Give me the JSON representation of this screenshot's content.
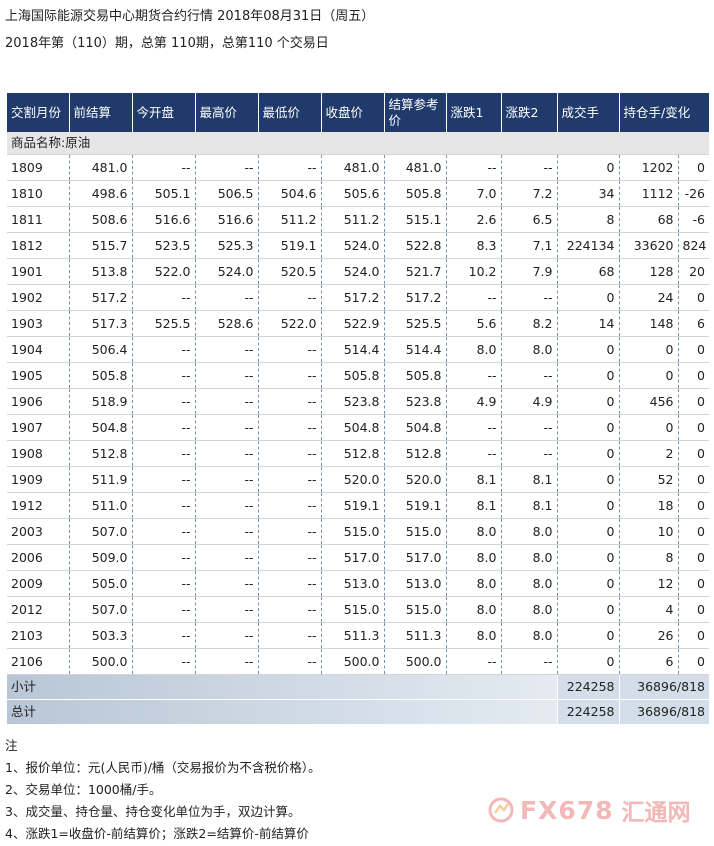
{
  "title_line1": "上海国际能源交易中心期货合约行情 2018年08月31日（周五）",
  "title_line2": "2018年第（110）期，总第 110期，总第110 个交易日",
  "table": {
    "headers": [
      "交割月份",
      "前结算",
      "今开盘",
      "最高价",
      "最低价",
      "收盘价",
      "结算参考价",
      "涨跌1",
      "涨跌2",
      "成交手",
      "持仓手/变化"
    ],
    "category": "商品名称:原油",
    "rows": [
      [
        "1809",
        "481.0",
        "--",
        "--",
        "--",
        "481.0",
        "481.0",
        "--",
        "--",
        "0",
        "1202",
        "0"
      ],
      [
        "1810",
        "498.6",
        "505.1",
        "506.5",
        "504.6",
        "505.6",
        "505.8",
        "7.0",
        "7.2",
        "34",
        "1112",
        "-26"
      ],
      [
        "1811",
        "508.6",
        "516.6",
        "516.6",
        "511.2",
        "511.2",
        "515.1",
        "2.6",
        "6.5",
        "8",
        "68",
        "-6"
      ],
      [
        "1812",
        "515.7",
        "523.5",
        "525.3",
        "519.1",
        "524.0",
        "522.8",
        "8.3",
        "7.1",
        "224134",
        "33620",
        "824"
      ],
      [
        "1901",
        "513.8",
        "522.0",
        "524.0",
        "520.5",
        "524.0",
        "521.7",
        "10.2",
        "7.9",
        "68",
        "128",
        "20"
      ],
      [
        "1902",
        "517.2",
        "--",
        "--",
        "--",
        "517.2",
        "517.2",
        "--",
        "--",
        "0",
        "24",
        "0"
      ],
      [
        "1903",
        "517.3",
        "525.5",
        "528.6",
        "522.0",
        "522.9",
        "525.5",
        "5.6",
        "8.2",
        "14",
        "148",
        "6"
      ],
      [
        "1904",
        "506.4",
        "--",
        "--",
        "--",
        "514.4",
        "514.4",
        "8.0",
        "8.0",
        "0",
        "0",
        "0"
      ],
      [
        "1905",
        "505.8",
        "--",
        "--",
        "--",
        "505.8",
        "505.8",
        "--",
        "--",
        "0",
        "0",
        "0"
      ],
      [
        "1906",
        "518.9",
        "--",
        "--",
        "--",
        "523.8",
        "523.8",
        "4.9",
        "4.9",
        "0",
        "456",
        "0"
      ],
      [
        "1907",
        "504.8",
        "--",
        "--",
        "--",
        "504.8",
        "504.8",
        "--",
        "--",
        "0",
        "0",
        "0"
      ],
      [
        "1908",
        "512.8",
        "--",
        "--",
        "--",
        "512.8",
        "512.8",
        "--",
        "--",
        "0",
        "2",
        "0"
      ],
      [
        "1909",
        "511.9",
        "--",
        "--",
        "--",
        "520.0",
        "520.0",
        "8.1",
        "8.1",
        "0",
        "52",
        "0"
      ],
      [
        "1912",
        "511.0",
        "--",
        "--",
        "--",
        "519.1",
        "519.1",
        "8.1",
        "8.1",
        "0",
        "18",
        "0"
      ],
      [
        "2003",
        "507.0",
        "--",
        "--",
        "--",
        "515.0",
        "515.0",
        "8.0",
        "8.0",
        "0",
        "10",
        "0"
      ],
      [
        "2006",
        "509.0",
        "--",
        "--",
        "--",
        "517.0",
        "517.0",
        "8.0",
        "8.0",
        "0",
        "8",
        "0"
      ],
      [
        "2009",
        "505.0",
        "--",
        "--",
        "--",
        "513.0",
        "513.0",
        "8.0",
        "8.0",
        "0",
        "12",
        "0"
      ],
      [
        "2012",
        "507.0",
        "--",
        "--",
        "--",
        "515.0",
        "515.0",
        "8.0",
        "8.0",
        "0",
        "4",
        "0"
      ],
      [
        "2103",
        "503.3",
        "--",
        "--",
        "--",
        "511.3",
        "511.3",
        "8.0",
        "8.0",
        "0",
        "26",
        "0"
      ],
      [
        "2106",
        "500.0",
        "--",
        "--",
        "--",
        "500.0",
        "500.0",
        "--",
        "--",
        "0",
        "6",
        "0"
      ]
    ],
    "subtotal": {
      "label": "小计",
      "volume": "224258",
      "oi": "36896/818"
    },
    "total": {
      "label": "总计",
      "volume": "224258",
      "oi": "36896/818"
    }
  },
  "notes": {
    "heading": "注",
    "items": [
      "1、报价单位：元(人民币)/桶（交易报价为不含税价格）。",
      "2、交易单位：1000桶/手。",
      "3、成交量、持仓量、持仓变化单位为手，双边计算。",
      "4、涨跌1=收盘价-前结算价；涨跌2=结算价-前结算价"
    ]
  },
  "watermark": {
    "text": "FX678",
    "cn": "汇通网",
    "icon": "fx678-logo-icon",
    "color": "#f2b7b7"
  }
}
